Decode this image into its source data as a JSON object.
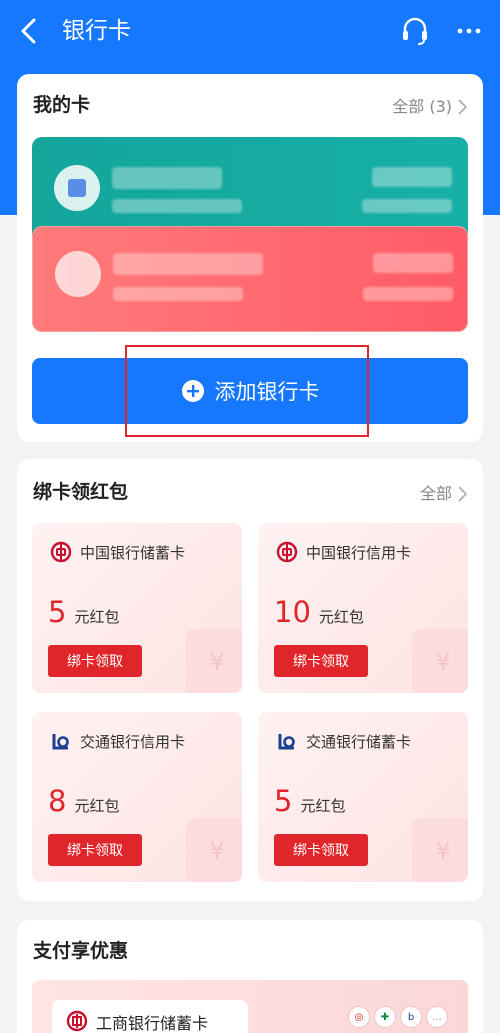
{
  "header": {
    "title": "银行卡"
  },
  "my_cards": {
    "title": "我的卡",
    "all_link": "全部 (3)",
    "add_button": "添加银行卡"
  },
  "red_packets": {
    "title": "绑卡领红包",
    "all_link": "全部",
    "items": [
      {
        "bank": "中国银行储蓄卡",
        "amount": "5",
        "unit": "元红包",
        "button": "绑卡领取",
        "icon": "boc-logo-icon"
      },
      {
        "bank": "中国银行信用卡",
        "amount": "10",
        "unit": "元红包",
        "button": "绑卡领取",
        "icon": "boc-logo-icon"
      },
      {
        "bank": "交通银行信用卡",
        "amount": "8",
        "unit": "元红包",
        "button": "绑卡领取",
        "icon": "bocom-logo-icon"
      },
      {
        "bank": "交通银行储蓄卡",
        "amount": "5",
        "unit": "元红包",
        "button": "绑卡领取",
        "icon": "bocom-logo-icon"
      }
    ]
  },
  "offers": {
    "title": "支付享优惠",
    "first_offer_bank": "工商银行储蓄卡"
  },
  "colors": {
    "primary": "#1677ff",
    "accent_red": "#e0262b"
  }
}
